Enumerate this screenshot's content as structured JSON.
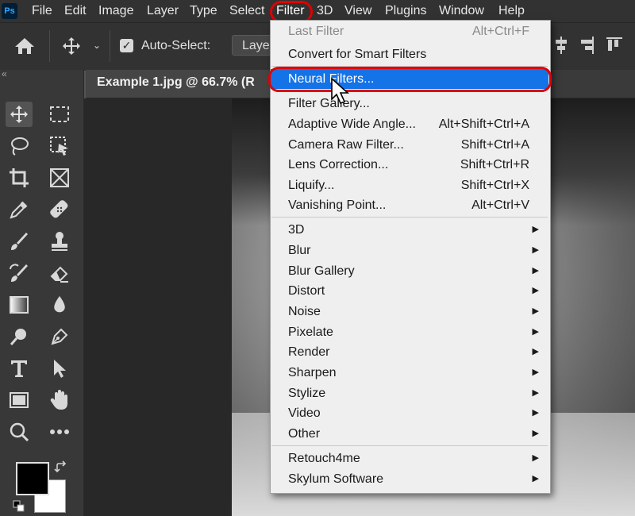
{
  "app": {
    "logo": "Ps"
  },
  "menubar": {
    "items": [
      "File",
      "Edit",
      "Image",
      "Layer",
      "Type",
      "Select",
      "Filter",
      "3D",
      "View",
      "Plugins",
      "Window",
      "Help"
    ],
    "active": "Filter"
  },
  "options": {
    "home_icon": "home-icon",
    "move_icon": "move-icon",
    "checkbox_mark": "✓",
    "auto_select_label": "Auto-Select:",
    "layer_dropdown": "Laye"
  },
  "collapse_glyph": "«",
  "document": {
    "tab_label": "Example 1.jpg @ 66.7% (R"
  },
  "tools": [
    "move-tool",
    "marquee-tool",
    "lasso-tool",
    "object-select-tool",
    "crop-tool",
    "frame-tool",
    "eyedropper-tool",
    "healing-brush-tool",
    "brush-tool",
    "stamp-tool",
    "history-brush-tool",
    "eraser-tool",
    "gradient-tool",
    "blur-tool",
    "dodge-tool",
    "pen-tool",
    "type-tool",
    "path-select-tool",
    "rectangle-tool",
    "hand-tool",
    "zoom-tool",
    "more-tools"
  ],
  "filter_menu": {
    "top": [
      {
        "label": "Last Filter",
        "shortcut": "Alt+Ctrl+F",
        "disabled": true
      },
      {
        "label": "Convert for Smart Filters",
        "shortcut": ""
      }
    ],
    "highlighted": {
      "label": "Neural Filters..."
    },
    "middle": [
      {
        "label": "Filter Gallery...",
        "shortcut": ""
      },
      {
        "label": "Adaptive Wide Angle...",
        "shortcut": "Alt+Shift+Ctrl+A"
      },
      {
        "label": "Camera Raw Filter...",
        "shortcut": "Shift+Ctrl+A"
      },
      {
        "label": "Lens Correction...",
        "shortcut": "Shift+Ctrl+R"
      },
      {
        "label": "Liquify...",
        "shortcut": "Shift+Ctrl+X"
      },
      {
        "label": "Vanishing Point...",
        "shortcut": "Alt+Ctrl+V"
      }
    ],
    "submenus": [
      "3D",
      "Blur",
      "Blur Gallery",
      "Distort",
      "Noise",
      "Pixelate",
      "Render",
      "Sharpen",
      "Stylize",
      "Video",
      "Other"
    ],
    "plugins": [
      "Retouch4me",
      "Skylum Software"
    ]
  },
  "colors": {
    "accent": "#1473e6",
    "annotation": "#e00000"
  }
}
